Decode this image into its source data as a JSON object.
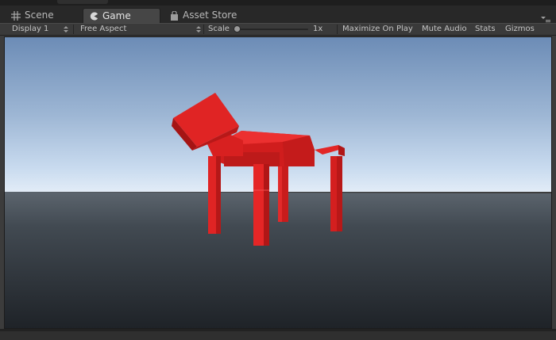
{
  "tabs": {
    "scene": {
      "label": "Scene",
      "icon": "grid-icon"
    },
    "game": {
      "label": "Game",
      "icon": "pacman-icon"
    },
    "asset_store": {
      "label": "Asset Store",
      "icon": "shopping-bag-icon"
    }
  },
  "toolbar": {
    "display": "Display 1",
    "aspect": "Free Aspect",
    "scale_label": "Scale",
    "scale_value": "1x",
    "scale_level": 0.0,
    "maximize": "Maximize On Play",
    "mute": "Mute Audio",
    "stats": "Stats",
    "gizmos": "Gizmos"
  },
  "colors": {
    "sky_top": "#6f8fb8",
    "horizon": "#d9e7f6",
    "ground": "#434b53",
    "object": "#e32222"
  }
}
